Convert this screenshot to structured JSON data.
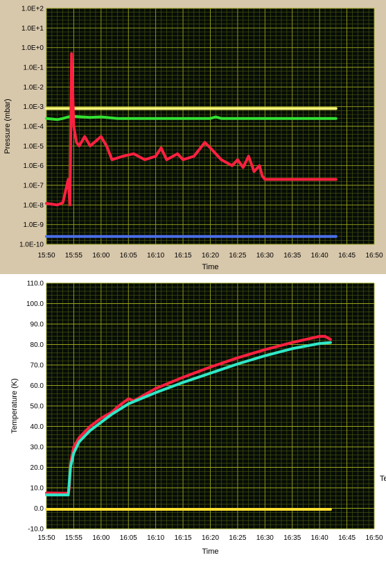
{
  "cut_label": "Te",
  "chart_data": [
    {
      "type": "line",
      "xlabel": "Time",
      "ylabel": "Pressure (mbar)",
      "y_scale": "log",
      "grid": true,
      "xlim": [
        "15:50",
        "16:50"
      ],
      "ylim_exponent": [
        -10,
        2
      ],
      "x_ticks": [
        "15:50",
        "15:55",
        "16:00",
        "16:05",
        "16:10",
        "16:15",
        "16:20",
        "16:25",
        "16:30",
        "16:35",
        "16:40",
        "16:45",
        "16:50"
      ],
      "y_ticks": [
        "1.0E-10",
        "1.0E-9",
        "1.0E-8",
        "1.0E-7",
        "1.0E-6",
        "1.0E-5",
        "1.0E-4",
        "1.0E-3",
        "1.0E-2",
        "1.0E-1",
        "1.0E+0",
        "1.0E+1",
        "1.0E+2"
      ],
      "series": [
        {
          "color": "#fffa78",
          "points": [
            [
              "15:50",
              0.0008
            ],
            [
              "16:43",
              0.0008
            ]
          ]
        },
        {
          "color": "#33e033",
          "points": [
            [
              "15:50",
              0.00025
            ],
            [
              "15:52",
              0.00022
            ],
            [
              "15:53",
              0.00025
            ],
            [
              "15:54",
              0.0003
            ],
            [
              "15:55",
              0.00032
            ],
            [
              "15:58",
              0.00028
            ],
            [
              "16:00",
              0.0003
            ],
            [
              "16:03",
              0.00025
            ],
            [
              "16:20",
              0.00025
            ],
            [
              "16:21",
              0.0003
            ],
            [
              "16:22",
              0.00025
            ],
            [
              "16:43",
              0.00025
            ]
          ]
        },
        {
          "color": "#ff2040",
          "points": [
            [
              "15:50",
              1.2e-08
            ],
            [
              "15:52",
              1e-08
            ],
            [
              "15:53",
              1.3e-08
            ],
            [
              "15:54",
              2e-07
            ],
            [
              "15:54.3",
              1e-08
            ],
            [
              "15:54.6",
              0.5
            ],
            [
              "15:54.8",
              0.01
            ],
            [
              "15:55",
              0.0001
            ],
            [
              "15:55.5",
              1.5e-05
            ],
            [
              "15:56",
              1e-05
            ],
            [
              "15:57",
              3e-05
            ],
            [
              "15:58",
              1e-05
            ],
            [
              "16:00",
              3e-05
            ],
            [
              "16:01",
              1e-05
            ],
            [
              "16:02",
              2e-06
            ],
            [
              "16:04",
              3e-06
            ],
            [
              "16:06",
              4e-06
            ],
            [
              "16:08",
              2e-06
            ],
            [
              "16:10",
              3e-06
            ],
            [
              "16:11",
              8e-06
            ],
            [
              "16:12",
              2e-06
            ],
            [
              "16:14",
              4e-06
            ],
            [
              "16:15",
              2e-06
            ],
            [
              "16:17",
              3e-06
            ],
            [
              "16:19",
              1.5e-05
            ],
            [
              "16:20",
              8e-06
            ],
            [
              "16:22",
              2e-06
            ],
            [
              "16:24",
              1e-06
            ],
            [
              "16:25",
              2e-06
            ],
            [
              "16:26",
              8e-07
            ],
            [
              "16:27",
              3e-06
            ],
            [
              "16:28",
              5e-07
            ],
            [
              "16:29",
              1e-06
            ],
            [
              "16:29.5",
              3e-07
            ],
            [
              "16:30",
              2e-07
            ],
            [
              "16:43",
              2e-07
            ]
          ]
        },
        {
          "color": "#4a6fe8",
          "points": [
            [
              "15:50",
              2.5e-10
            ],
            [
              "16:43",
              2.5e-10
            ]
          ]
        }
      ]
    },
    {
      "type": "line",
      "xlabel": "Time",
      "ylabel": "Temperature (K)",
      "grid": true,
      "xlim": [
        "15:50",
        "16:50"
      ],
      "ylim": [
        -10,
        110
      ],
      "x_ticks": [
        "15:50",
        "15:55",
        "16:00",
        "16:05",
        "16:10",
        "16:15",
        "16:20",
        "16:25",
        "16:30",
        "16:35",
        "16:40",
        "16:45",
        "16:50"
      ],
      "y_ticks": [
        "-10.0",
        "0.0",
        "10.0",
        "20.0",
        "30.0",
        "40.0",
        "50.0",
        "60.0",
        "70.0",
        "80.0",
        "90.0",
        "100.0",
        "110.0"
      ],
      "series": [
        {
          "color": "#ff2040",
          "points": [
            [
              "15:50",
              7.5
            ],
            [
              "15:54",
              7.3
            ],
            [
              "15:54.2",
              10
            ],
            [
              "15:54.4",
              22
            ],
            [
              "15:55",
              30
            ],
            [
              "15:56",
              34.5
            ],
            [
              "15:58",
              40
            ],
            [
              "16:00",
              44
            ],
            [
              "16:02",
              47
            ],
            [
              "16:03",
              49.5
            ],
            [
              "16:05",
              53.5
            ],
            [
              "16:06",
              52.5
            ],
            [
              "16:10",
              58.5
            ],
            [
              "16:15",
              64
            ],
            [
              "16:20",
              69
            ],
            [
              "16:25",
              73.5
            ],
            [
              "16:30",
              77.5
            ],
            [
              "16:35",
              81
            ],
            [
              "16:40",
              84
            ],
            [
              "16:41",
              84
            ],
            [
              "16:42",
              82.5
            ]
          ]
        },
        {
          "color": "#30e8c8",
          "points": [
            [
              "15:50",
              6.5
            ],
            [
              "15:54",
              6.5
            ],
            [
              "15:54.4",
              20
            ],
            [
              "15:55",
              27
            ],
            [
              "15:56",
              32.5
            ],
            [
              "15:58",
              38
            ],
            [
              "16:00",
              42
            ],
            [
              "16:02",
              46
            ],
            [
              "16:05",
              51
            ],
            [
              "16:10",
              56.5
            ],
            [
              "16:15",
              61.5
            ],
            [
              "16:20",
              66
            ],
            [
              "16:25",
              70.5
            ],
            [
              "16:30",
              74.5
            ],
            [
              "16:35",
              78
            ],
            [
              "16:40",
              80.5
            ],
            [
              "16:42",
              81
            ]
          ]
        },
        {
          "color": "#ffe030",
          "points": [
            [
              "15:50",
              -0.5
            ],
            [
              "16:42",
              -0.5
            ]
          ]
        }
      ]
    }
  ]
}
